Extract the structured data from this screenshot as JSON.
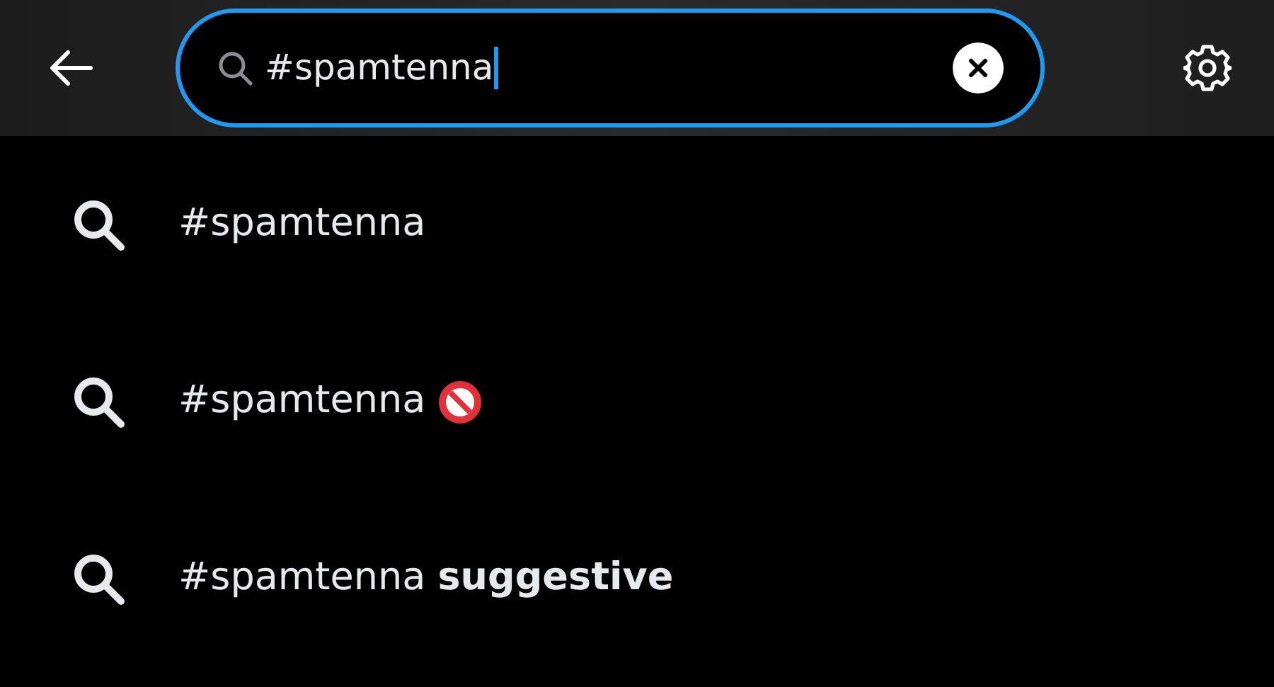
{
  "search": {
    "value": "#spamtenna",
    "focused": true
  },
  "suggestions": [
    {
      "text": "#spamtenna",
      "adult_badge": false
    },
    {
      "text": "#spamtenna",
      "adult_badge": true
    },
    {
      "text": "#spamtenna **suggestive**",
      "adult_badge": false
    }
  ]
}
